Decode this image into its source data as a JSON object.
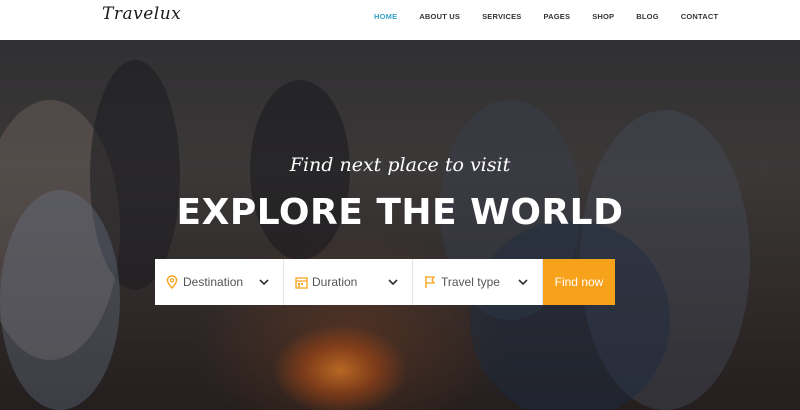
{
  "header": {
    "logo": "Travelux",
    "nav": [
      {
        "label": "HOME",
        "active": true
      },
      {
        "label": "ABOUT US"
      },
      {
        "label": "SERVICES"
      },
      {
        "label": "PAGES"
      },
      {
        "label": "SHOP"
      },
      {
        "label": "BLOG"
      },
      {
        "label": "CONTACT"
      }
    ]
  },
  "hero": {
    "tagline": "Find next place to visit",
    "headline": "EXPLORE THE WORLD",
    "search": {
      "destination": {
        "label": "Destination",
        "icon": "map-pin-icon"
      },
      "duration": {
        "label": "Duration",
        "icon": "calendar-icon"
      },
      "travel_type": {
        "label": "Travel type",
        "icon": "flag-icon"
      },
      "button": "Find now"
    }
  },
  "colors": {
    "accent": "#3aa5c6",
    "button": "#f7a21b",
    "icon": "#f7a21b"
  }
}
